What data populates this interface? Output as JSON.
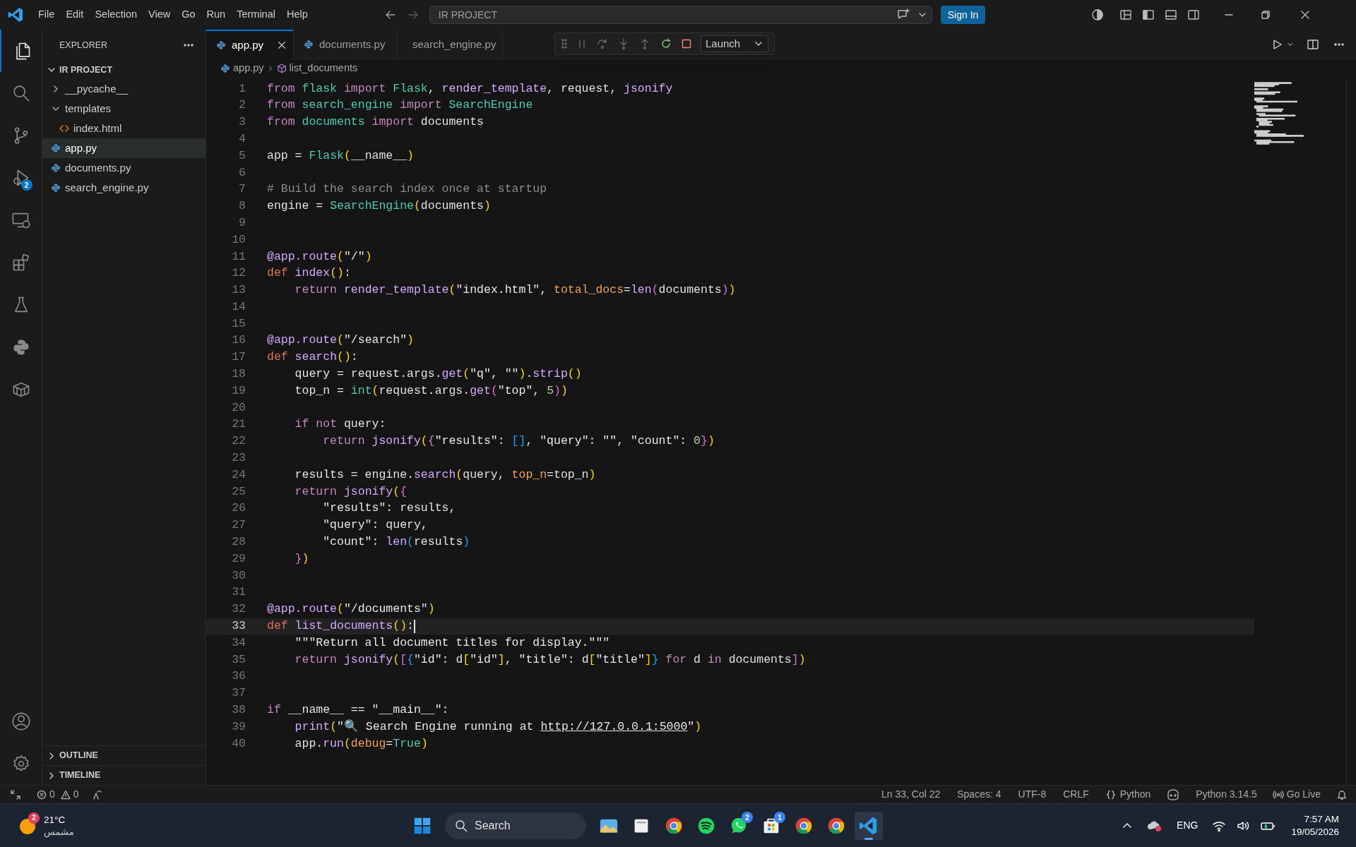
{
  "title_bar": {
    "menu": [
      "File",
      "Edit",
      "Selection",
      "View",
      "Go",
      "Run",
      "Terminal",
      "Help"
    ],
    "command_center": "IR PROJECT",
    "sign_in": "Sign In"
  },
  "activity_bar": {
    "items": [
      {
        "kind": "files",
        "selected": true
      },
      {
        "kind": "search",
        "selected": false
      },
      {
        "kind": "source-control",
        "selected": false
      },
      {
        "kind": "run-debug",
        "selected": false,
        "badge": "2"
      },
      {
        "kind": "remote",
        "selected": false
      },
      {
        "kind": "extensions",
        "selected": false
      },
      {
        "kind": "testing",
        "selected": false
      },
      {
        "kind": "python",
        "selected": false
      },
      {
        "kind": "containers",
        "selected": false
      }
    ]
  },
  "sidebar": {
    "title": "EXPLORER",
    "project": {
      "label": "IR PROJECT",
      "expanded": true
    },
    "tree": [
      {
        "label": "__pycache__",
        "kind": "folder",
        "expanded": false,
        "selected": false
      },
      {
        "label": "templates",
        "kind": "folder",
        "expanded": true,
        "selected": false,
        "children": [
          {
            "label": "index.html",
            "kind": "html",
            "selected": false
          }
        ]
      },
      {
        "label": "app.py",
        "kind": "python",
        "selected": true
      },
      {
        "label": "documents.py",
        "kind": "python",
        "selected": false
      },
      {
        "label": "search_engine.py",
        "kind": "python",
        "selected": false
      }
    ],
    "panels": [
      {
        "label": "OUTLINE",
        "expanded": false
      },
      {
        "label": "TIMELINE",
        "expanded": false
      }
    ]
  },
  "tabs": [
    {
      "label": "app.py",
      "selected": true
    },
    {
      "label": "documents.py",
      "selected": false
    },
    {
      "label": "search_engine.py",
      "selected": false
    }
  ],
  "debug_toolbar": {
    "configuration": "Launch"
  },
  "breadcrumb": [
    "app.py",
    "list_documents"
  ],
  "editor": {
    "lines": [
      {
        "number": "1",
        "current": false,
        "tokens": [
          {
            "text": "from",
            "kind": "kw"
          },
          {
            "text": " flask ",
            "kind": "type"
          },
          {
            "text": "import",
            "kind": "kw"
          },
          {
            "text": " Flask",
            "kind": "type"
          },
          {
            "text": ", ",
            "kind": "plain"
          },
          {
            "text": "render_template",
            "kind": "fn"
          },
          {
            "text": ", request, ",
            "kind": "plain"
          },
          {
            "text": "jsonify",
            "kind": "fn"
          }
        ]
      },
      {
        "number": "2",
        "current": false,
        "tokens": [
          {
            "text": "from",
            "kind": "kw"
          },
          {
            "text": " search_engine ",
            "kind": "type"
          },
          {
            "text": "import",
            "kind": "kw"
          },
          {
            "text": " SearchEngine",
            "kind": "type"
          }
        ]
      },
      {
        "number": "3",
        "current": false,
        "tokens": [
          {
            "text": "from",
            "kind": "kw"
          },
          {
            "text": " documents ",
            "kind": "type"
          },
          {
            "text": "import",
            "kind": "kw"
          },
          {
            "text": " documents",
            "kind": "plain"
          }
        ]
      },
      {
        "number": "4",
        "current": false
      },
      {
        "number": "5",
        "current": false,
        "tokens": [
          {
            "text": "app = ",
            "kind": "plain"
          },
          {
            "text": "Flask",
            "kind": "type"
          },
          {
            "text": "(",
            "kind": "br1"
          },
          {
            "text": "__name__",
            "kind": "plain"
          },
          {
            "text": ")",
            "kind": "br1"
          }
        ]
      },
      {
        "number": "6",
        "current": false
      },
      {
        "number": "7",
        "current": false,
        "tokens": [
          {
            "text": "# Build the search index once at startup",
            "kind": "cmt"
          }
        ]
      },
      {
        "number": "8",
        "current": false,
        "tokens": [
          {
            "text": "engine = ",
            "kind": "plain"
          },
          {
            "text": "SearchEngine",
            "kind": "type"
          },
          {
            "text": "(",
            "kind": "br1"
          },
          {
            "text": "documents",
            "kind": "plain"
          },
          {
            "text": ")",
            "kind": "br1"
          }
        ]
      },
      {
        "number": "9",
        "current": false
      },
      {
        "number": "10",
        "current": false
      },
      {
        "number": "11",
        "current": false,
        "tokens": [
          {
            "text": "@app.route",
            "kind": "fn"
          },
          {
            "text": "(",
            "kind": "br1"
          },
          {
            "text": "\"/\"",
            "kind": "str"
          },
          {
            "text": ")",
            "kind": "br1"
          }
        ]
      },
      {
        "number": "12",
        "current": false,
        "tokens": [
          {
            "text": "def",
            "kind": "def"
          },
          {
            "text": " index",
            "kind": "fn"
          },
          {
            "text": "()",
            "kind": "br1"
          },
          {
            "text": ":",
            "kind": "plain"
          }
        ]
      },
      {
        "number": "13",
        "current": false,
        "tokens": [
          {
            "text": "    return",
            "kind": "kw"
          },
          {
            "text": " render_template",
            "kind": "fn"
          },
          {
            "text": "(",
            "kind": "br1"
          },
          {
            "text": "\"index.html\"",
            "kind": "str"
          },
          {
            "text": ", ",
            "kind": "plain"
          },
          {
            "text": "total_docs",
            "kind": "arg"
          },
          {
            "text": "=",
            "kind": "plain"
          },
          {
            "text": "len",
            "kind": "fn"
          },
          {
            "text": "(",
            "kind": "br2"
          },
          {
            "text": "documents",
            "kind": "plain"
          },
          {
            "text": ")",
            "kind": "br2"
          },
          {
            "text": ")",
            "kind": "br1"
          }
        ]
      },
      {
        "number": "14",
        "current": false
      },
      {
        "number": "15",
        "current": false
      },
      {
        "number": "16",
        "current": false,
        "tokens": [
          {
            "text": "@app.route",
            "kind": "fn"
          },
          {
            "text": "(",
            "kind": "br1"
          },
          {
            "text": "\"/search\"",
            "kind": "str"
          },
          {
            "text": ")",
            "kind": "br1"
          }
        ]
      },
      {
        "number": "17",
        "current": false,
        "tokens": [
          {
            "text": "def",
            "kind": "def"
          },
          {
            "text": " search",
            "kind": "fn"
          },
          {
            "text": "()",
            "kind": "br1"
          },
          {
            "text": ":",
            "kind": "plain"
          }
        ]
      },
      {
        "number": "18",
        "current": false,
        "tokens": [
          {
            "text": "    query = request.args.",
            "kind": "plain"
          },
          {
            "text": "get",
            "kind": "fn"
          },
          {
            "text": "(",
            "kind": "br1"
          },
          {
            "text": "\"q\"",
            "kind": "str"
          },
          {
            "text": ", ",
            "kind": "plain"
          },
          {
            "text": "\"\"",
            "kind": "str"
          },
          {
            "text": ")",
            "kind": "br1"
          },
          {
            "text": ".",
            "kind": "plain"
          },
          {
            "text": "strip",
            "kind": "fn"
          },
          {
            "text": "()",
            "kind": "br1"
          }
        ]
      },
      {
        "number": "19",
        "current": false,
        "tokens": [
          {
            "text": "    top_n = ",
            "kind": "plain"
          },
          {
            "text": "int",
            "kind": "type"
          },
          {
            "text": "(",
            "kind": "br1"
          },
          {
            "text": "request.args.",
            "kind": "plain"
          },
          {
            "text": "get",
            "kind": "fn"
          },
          {
            "text": "(",
            "kind": "br2"
          },
          {
            "text": "\"top\"",
            "kind": "str"
          },
          {
            "text": ", ",
            "kind": "plain"
          },
          {
            "text": "5",
            "kind": "num"
          },
          {
            "text": ")",
            "kind": "br2"
          },
          {
            "text": ")",
            "kind": "br1"
          }
        ]
      },
      {
        "number": "20",
        "current": false
      },
      {
        "number": "21",
        "current": false,
        "tokens": [
          {
            "text": "    if",
            "kind": "kw"
          },
          {
            "text": " not",
            "kind": "kw"
          },
          {
            "text": " query:",
            "kind": "plain"
          }
        ]
      },
      {
        "number": "22",
        "current": false,
        "tokens": [
          {
            "text": "        return",
            "kind": "kw"
          },
          {
            "text": " jsonify",
            "kind": "fn"
          },
          {
            "text": "(",
            "kind": "br1"
          },
          {
            "text": "{",
            "kind": "br2"
          },
          {
            "text": "\"results\"",
            "kind": "str"
          },
          {
            "text": ": ",
            "kind": "plain"
          },
          {
            "text": "[]",
            "kind": "br3"
          },
          {
            "text": ", ",
            "kind": "plain"
          },
          {
            "text": "\"query\"",
            "kind": "str"
          },
          {
            "text": ": ",
            "kind": "plain"
          },
          {
            "text": "\"\"",
            "kind": "str"
          },
          {
            "text": ", ",
            "kind": "plain"
          },
          {
            "text": "\"count\"",
            "kind": "str"
          },
          {
            "text": ": ",
            "kind": "plain"
          },
          {
            "text": "0",
            "kind": "num"
          },
          {
            "text": "}",
            "kind": "br2"
          },
          {
            "text": ")",
            "kind": "br1"
          }
        ]
      },
      {
        "number": "23",
        "current": false
      },
      {
        "number": "24",
        "current": false,
        "tokens": [
          {
            "text": "    results = engine.",
            "kind": "plain"
          },
          {
            "text": "search",
            "kind": "fn"
          },
          {
            "text": "(",
            "kind": "br1"
          },
          {
            "text": "query, ",
            "kind": "plain"
          },
          {
            "text": "top_n",
            "kind": "arg"
          },
          {
            "text": "=top_n",
            "kind": "plain"
          },
          {
            "text": ")",
            "kind": "br1"
          }
        ]
      },
      {
        "number": "25",
        "current": false,
        "tokens": [
          {
            "text": "    return",
            "kind": "kw"
          },
          {
            "text": " jsonify",
            "kind": "fn"
          },
          {
            "text": "(",
            "kind": "br1"
          },
          {
            "text": "{",
            "kind": "br2"
          }
        ]
      },
      {
        "number": "26",
        "current": false,
        "tokens": [
          {
            "text": "        \"results\"",
            "kind": "str"
          },
          {
            "text": ": results,",
            "kind": "plain"
          }
        ]
      },
      {
        "number": "27",
        "current": false,
        "tokens": [
          {
            "text": "        \"query\"",
            "kind": "str"
          },
          {
            "text": ": query,",
            "kind": "plain"
          }
        ]
      },
      {
        "number": "28",
        "current": false,
        "tokens": [
          {
            "text": "        \"count\"",
            "kind": "str"
          },
          {
            "text": ": ",
            "kind": "plain"
          },
          {
            "text": "len",
            "kind": "fn"
          },
          {
            "text": "(",
            "kind": "br3"
          },
          {
            "text": "results",
            "kind": "plain"
          },
          {
            "text": ")",
            "kind": "br3"
          }
        ]
      },
      {
        "number": "29",
        "current": false,
        "tokens": [
          {
            "text": "    }",
            "kind": "br2"
          },
          {
            "text": ")",
            "kind": "br1"
          }
        ]
      },
      {
        "number": "30",
        "current": false
      },
      {
        "number": "31",
        "current": false
      },
      {
        "number": "32",
        "current": false,
        "tokens": [
          {
            "text": "@app.route",
            "kind": "fn"
          },
          {
            "text": "(",
            "kind": "br1"
          },
          {
            "text": "\"/documents\"",
            "kind": "str"
          },
          {
            "text": ")",
            "kind": "br1"
          }
        ]
      },
      {
        "number": "33",
        "current": true,
        "tokens": [
          {
            "text": "def",
            "kind": "def"
          },
          {
            "text": " list_documents",
            "kind": "fn"
          },
          {
            "text": "()",
            "kind": "br1"
          },
          {
            "text": ":",
            "kind": "plain"
          }
        ]
      },
      {
        "number": "34",
        "current": false,
        "tokens": [
          {
            "text": "    \"\"\"Return all document titles for display.\"\"\"",
            "kind": "str"
          }
        ]
      },
      {
        "number": "35",
        "current": false,
        "tokens": [
          {
            "text": "    return",
            "kind": "kw"
          },
          {
            "text": " jsonify",
            "kind": "fn"
          },
          {
            "text": "(",
            "kind": "br1"
          },
          {
            "text": "[",
            "kind": "br2"
          },
          {
            "text": "{",
            "kind": "br3"
          },
          {
            "text": "\"id\"",
            "kind": "str"
          },
          {
            "text": ": d",
            "kind": "plain"
          },
          {
            "text": "[",
            "kind": "br1"
          },
          {
            "text": "\"id\"",
            "kind": "str"
          },
          {
            "text": "]",
            "kind": "br1"
          },
          {
            "text": ", ",
            "kind": "plain"
          },
          {
            "text": "\"title\"",
            "kind": "str"
          },
          {
            "text": ": d",
            "kind": "plain"
          },
          {
            "text": "[",
            "kind": "br1"
          },
          {
            "text": "\"title\"",
            "kind": "str"
          },
          {
            "text": "]",
            "kind": "br1"
          },
          {
            "text": "}",
            "kind": "br3"
          },
          {
            "text": " for",
            "kind": "kw"
          },
          {
            "text": " d ",
            "kind": "plain"
          },
          {
            "text": "in",
            "kind": "kw"
          },
          {
            "text": " documents",
            "kind": "plain"
          },
          {
            "text": "]",
            "kind": "br2"
          },
          {
            "text": ")",
            "kind": "br1"
          }
        ]
      },
      {
        "number": "36",
        "current": false
      },
      {
        "number": "37",
        "current": false
      },
      {
        "number": "38",
        "current": false,
        "tokens": [
          {
            "text": "if",
            "kind": "kw"
          },
          {
            "text": " __name__ == ",
            "kind": "plain"
          },
          {
            "text": "\"__main__\"",
            "kind": "str"
          },
          {
            "text": ":",
            "kind": "plain"
          }
        ]
      },
      {
        "number": "39",
        "current": false,
        "tokens": [
          {
            "text": "    print",
            "kind": "fn"
          },
          {
            "text": "(",
            "kind": "br1"
          },
          {
            "text": "\"🔍 Search Engine running at ",
            "kind": "str"
          },
          {
            "text": "http://127.0.0.1:5000",
            "kind": "link"
          },
          {
            "text": "\"",
            "kind": "str"
          },
          {
            "text": ")",
            "kind": "br1"
          }
        ]
      },
      {
        "number": "40",
        "current": false,
        "tokens": [
          {
            "text": "    app.",
            "kind": "plain"
          },
          {
            "text": "run",
            "kind": "fn"
          },
          {
            "text": "(",
            "kind": "br1"
          },
          {
            "text": "debug",
            "kind": "arg"
          },
          {
            "text": "=",
            "kind": "plain"
          },
          {
            "text": "True",
            "kind": "type"
          },
          {
            "text": ")",
            "kind": "br1"
          }
        ]
      }
    ]
  },
  "status_bar": {
    "errors": "0",
    "warnings": "0",
    "items": [
      {
        "kind": "text",
        "text": "Ln 33, Col 22"
      },
      {
        "kind": "text",
        "text": "Spaces: 4"
      },
      {
        "kind": "text",
        "text": "UTF-8"
      },
      {
        "kind": "text",
        "text": "CRLF"
      },
      {
        "kind": "language",
        "text": "Python"
      },
      {
        "kind": "copilot"
      },
      {
        "kind": "text",
        "text": "Python 3.14.5"
      },
      {
        "kind": "live",
        "text": "Go Live"
      },
      {
        "kind": "bell"
      }
    ]
  },
  "taskbar": {
    "weather": {
      "badge": "2",
      "temperature": "21°C",
      "condition": "مشمس"
    },
    "search": "Search",
    "apps": [
      {
        "kind": "start",
        "selected": false
      },
      {
        "kind": "photos",
        "selected": false
      },
      {
        "kind": "files",
        "selected": false
      },
      {
        "kind": "chrome",
        "selected": false
      },
      {
        "kind": "spotify",
        "selected": false
      },
      {
        "kind": "whatsapp",
        "selected": false,
        "badge": "2"
      },
      {
        "kind": "store",
        "selected": false,
        "badge": "1"
      },
      {
        "kind": "chrome",
        "selected": false
      },
      {
        "kind": "chrome",
        "selected": false
      },
      {
        "kind": "vscode",
        "selected": true
      }
    ],
    "tray": {
      "language": "ENG",
      "time": "7:57 AM",
      "date": "19/05/2026"
    }
  }
}
